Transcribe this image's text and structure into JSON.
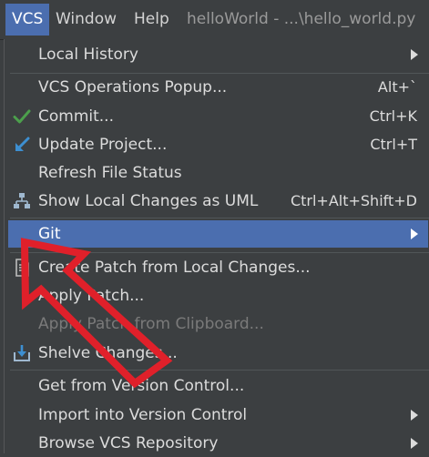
{
  "menubar": {
    "vcs": "VCS",
    "window": "Window",
    "help": "Help",
    "title": "helloWorld - ...\\hello_world.py"
  },
  "menu": {
    "local_history": "Local History",
    "vcs_operations_popup": "VCS Operations Popup...",
    "vcs_operations_popup_shortcut": "Alt+`",
    "commit": "Commit...",
    "commit_shortcut": "Ctrl+K",
    "update_project": "Update Project...",
    "update_project_shortcut": "Ctrl+T",
    "refresh_file_status": "Refresh File Status",
    "show_local_changes_uml": "Show Local Changes as UML",
    "show_local_changes_uml_shortcut": "Ctrl+Alt+Shift+D",
    "git": "Git",
    "create_patch": "Create Patch from Local Changes...",
    "apply_patch": "Apply Patch...",
    "apply_patch_clipboard": "Apply Patch from Clipboard...",
    "shelve_changes": "Shelve Changes...",
    "get_from_vcs": "Get from Version Control...",
    "import_into_vcs": "Import into Version Control",
    "browse_vcs_repo": "Browse VCS Repository"
  },
  "icons": {
    "commit": "checkmark-icon",
    "update_project": "arrow-down-left-icon",
    "show_local_changes_uml": "diagram-icon",
    "create_patch": "patch-document-icon",
    "shelve_changes": "shelve-icon",
    "annotation": "red-arrow-icon"
  },
  "colors": {
    "menu_background": "#3c3f41",
    "selection": "#4b6eaf",
    "text": "#dcdcdc",
    "disabled_text": "#7a7a7a",
    "commit_check": "#4c9f4c",
    "update_arrow": "#3d8fd1",
    "annotation_red": "#e0202a"
  },
  "selected_item": "Git"
}
